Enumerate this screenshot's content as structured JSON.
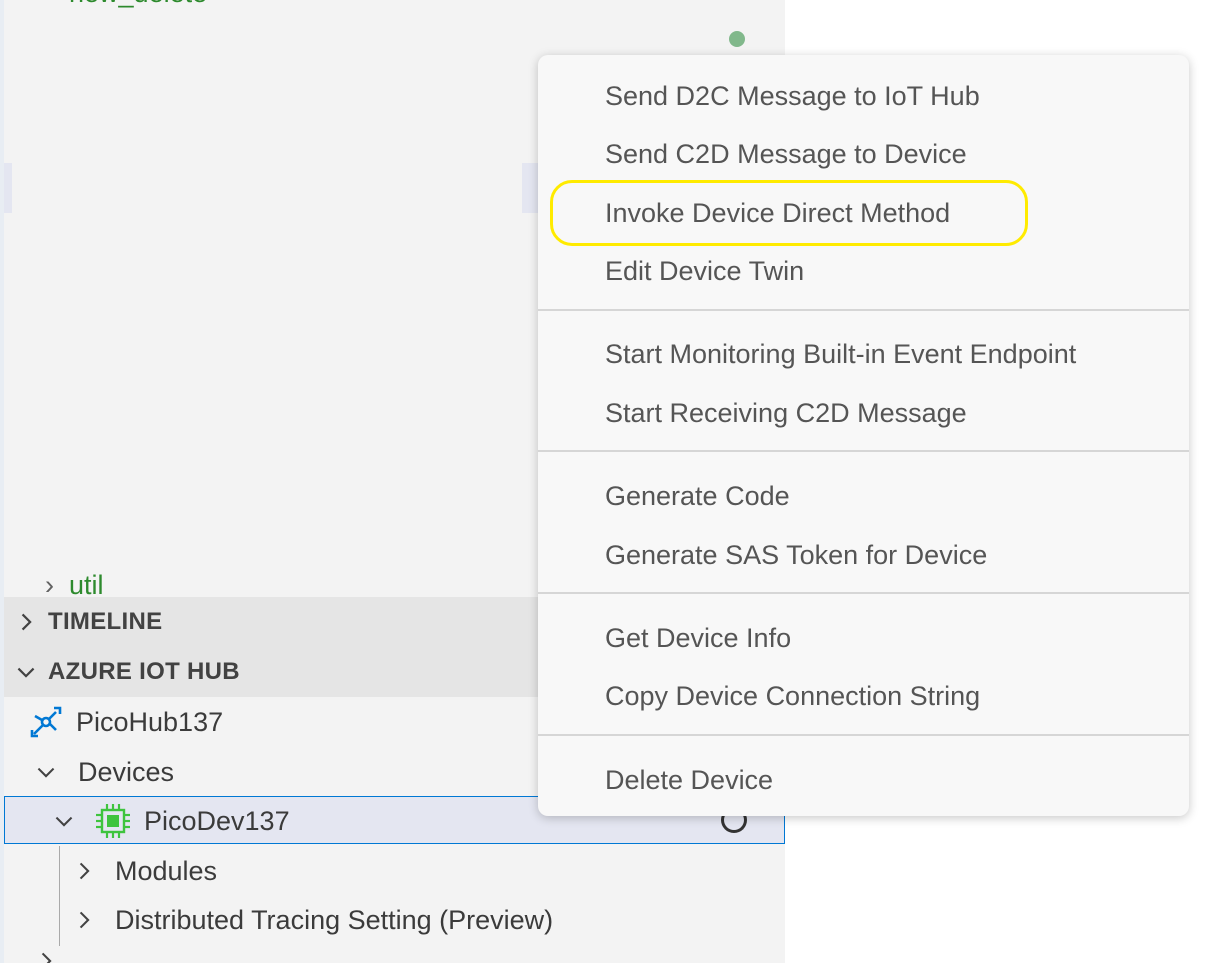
{
  "explorer": {
    "partial_top_label": "new_delete",
    "partial_mid_label": "util",
    "timeline_header": "TIMELINE",
    "azure_header": "AZURE IOT HUB",
    "hub_name": "PicoHub137",
    "devices_label": "Devices",
    "device_name": "PicoDev137",
    "modules_label": "Modules",
    "tracing_label": "Distributed Tracing Setting (Preview)"
  },
  "context_menu": {
    "items": [
      "Send D2C Message to IoT Hub",
      "Send C2D Message to Device",
      "Invoke Device Direct Method",
      "Edit Device Twin",
      "Start Monitoring Built-in Event Endpoint",
      "Start Receiving C2D Message",
      "Generate Code",
      "Generate SAS Token for Device",
      "Get Device Info",
      "Copy Device Connection String",
      "Delete Device"
    ]
  },
  "colors": {
    "highlight_ring": "#ffeb00",
    "selection_border": "#0078d4",
    "device_icon": "#3ec43e",
    "hub_icon": "#0078d4",
    "git_added_text": "#2d8a2d",
    "status_dot": "#81b88b"
  },
  "icons": {
    "hub": "iot-hub-icon",
    "device": "chip-icon",
    "loading": "spinner-icon"
  }
}
